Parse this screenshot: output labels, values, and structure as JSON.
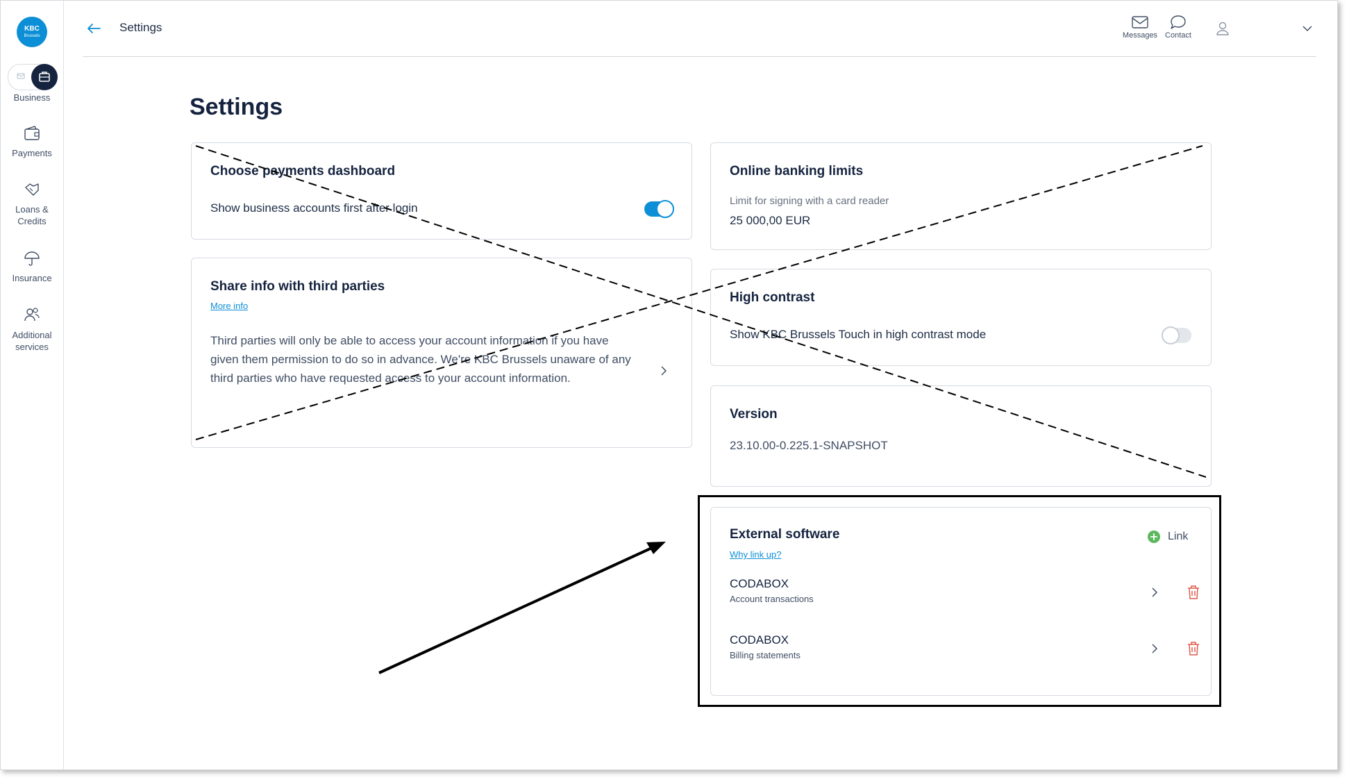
{
  "logo": {
    "line1": "KBC",
    "line2": "Brussels"
  },
  "sidebar": {
    "segment_label": "Business",
    "items": [
      {
        "label": "Payments",
        "icon": "wallet-icon"
      },
      {
        "label": "Loans &\nCredits",
        "icon": "handshake-icon"
      },
      {
        "label": "Insurance",
        "icon": "umbrella-icon"
      },
      {
        "label": "Additional\nservices",
        "icon": "people-icon"
      }
    ]
  },
  "header": {
    "title": "Settings",
    "messages_label": "Messages",
    "contact_label": "Contact"
  },
  "page": {
    "title": "Settings"
  },
  "cards": {
    "dashboard": {
      "title": "Choose payments dashboard",
      "option": "Show business accounts first after login",
      "toggle_on": true
    },
    "share": {
      "title": "Share info with third parties",
      "link": "More info",
      "text": "Third parties will only be able to access your account information if you have given them permission to do so in advance. We're KBC Brussels unaware of any third parties who have requested access to your account information."
    },
    "limits": {
      "title": "Online banking limits",
      "label": "Limit for signing with a card reader",
      "value": "25 000,00 EUR"
    },
    "contrast": {
      "title": "High contrast",
      "option": "Show KBC Brussels Touch in high contrast mode",
      "toggle_on": false
    },
    "version": {
      "title": "Version",
      "value": "23.10.00-0.225.1-SNAPSHOT"
    },
    "external": {
      "title": "External software",
      "link": "Why link up?",
      "add_label": "Link",
      "items": [
        {
          "name": "CODABOX",
          "detail": "Account transactions"
        },
        {
          "name": "CODABOX",
          "detail": "Billing statements"
        }
      ]
    }
  },
  "colors": {
    "accent": "#0c8fd6",
    "navy": "#15233f",
    "delete": "#e05a4a",
    "add": "#5cb85c"
  }
}
